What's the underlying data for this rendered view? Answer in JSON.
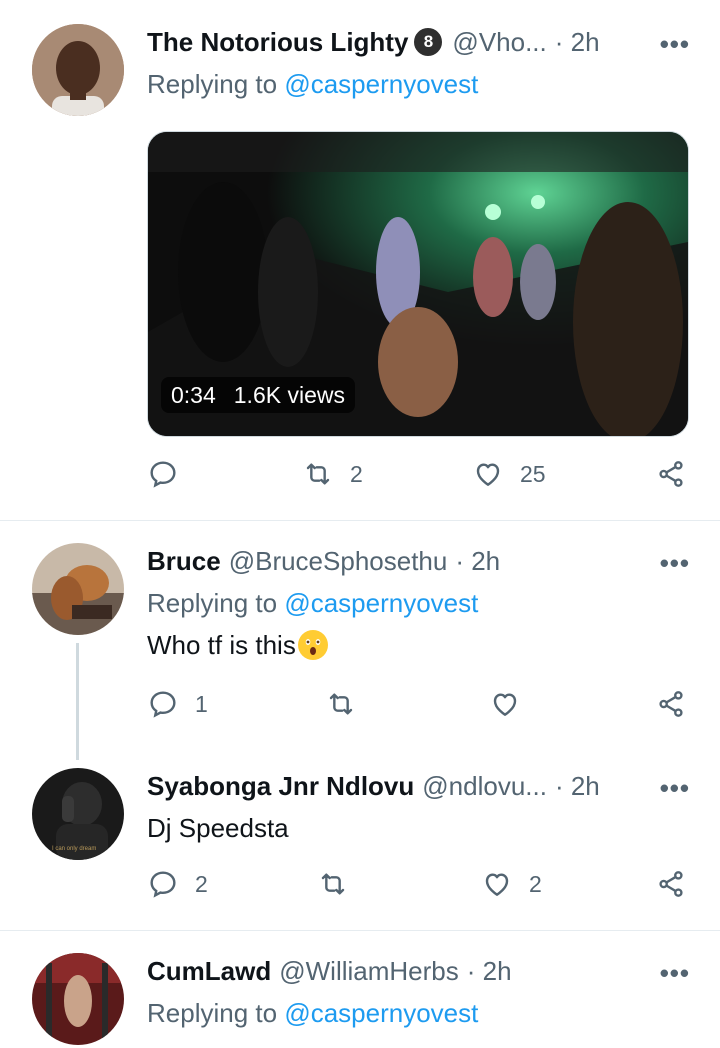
{
  "tweets": [
    {
      "name": "The Notorious Lighty",
      "badge": "8",
      "handle": "@Vho...",
      "time": "· 2h",
      "replying_prefix": "Replying to ",
      "replying_to": "@caspernyovest",
      "media": {
        "duration": "0:34",
        "views": "1.6K views"
      },
      "actions": {
        "replies": "",
        "retweets": "2",
        "likes": "25"
      }
    },
    {
      "name": "Bruce",
      "handle": "@BruceSphosethu",
      "time": "· 2h",
      "replying_prefix": "Replying to ",
      "replying_to": "@caspernyovest",
      "text": "Who tf is this",
      "emoji": "astonished-face",
      "actions": {
        "replies": "1",
        "retweets": "",
        "likes": ""
      }
    },
    {
      "name": "Syabonga Jnr Ndlovu",
      "handle": "@ndlovu...",
      "time": "· 2h",
      "text": "Dj Speedsta",
      "avatar_caption": "I can only dream",
      "actions": {
        "replies": "2",
        "retweets": "",
        "likes": "2"
      }
    },
    {
      "name": "CumLawd",
      "handle": "@WilliamHerbs",
      "time": "· 2h",
      "replying_prefix": "Replying to ",
      "replying_to": "@caspernyovest"
    }
  ],
  "more_label": "•••",
  "colors": {
    "accent": "#1d9bf0",
    "secondary": "#536471",
    "divider": "#e6ecf0"
  }
}
